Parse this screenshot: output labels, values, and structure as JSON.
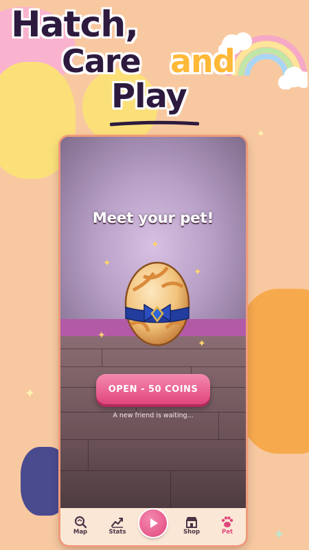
{
  "headline": {
    "line1": "Hatch,",
    "line2": "Care",
    "accent": "and",
    "line3": "Play"
  },
  "screen": {
    "title": "Meet your pet!",
    "open_button": "OPEN - 50 COINS",
    "subtitle": "A new friend is waiting..."
  },
  "nav": {
    "items": [
      {
        "label": "Map",
        "icon": "map-search-icon"
      },
      {
        "label": "Stats",
        "icon": "stats-chart-icon"
      },
      {
        "label": "",
        "icon": "play-icon"
      },
      {
        "label": "Shop",
        "icon": "shop-icon"
      },
      {
        "label": "Pet",
        "icon": "paw-icon"
      }
    ],
    "active": "Pet"
  },
  "colors": {
    "background": "#f8c9a1",
    "headline_dark": "#2d1a3e",
    "headline_accent": "#ffb938",
    "primary_pink": "#e1457c",
    "egg_ribbon": "#233d9e"
  }
}
